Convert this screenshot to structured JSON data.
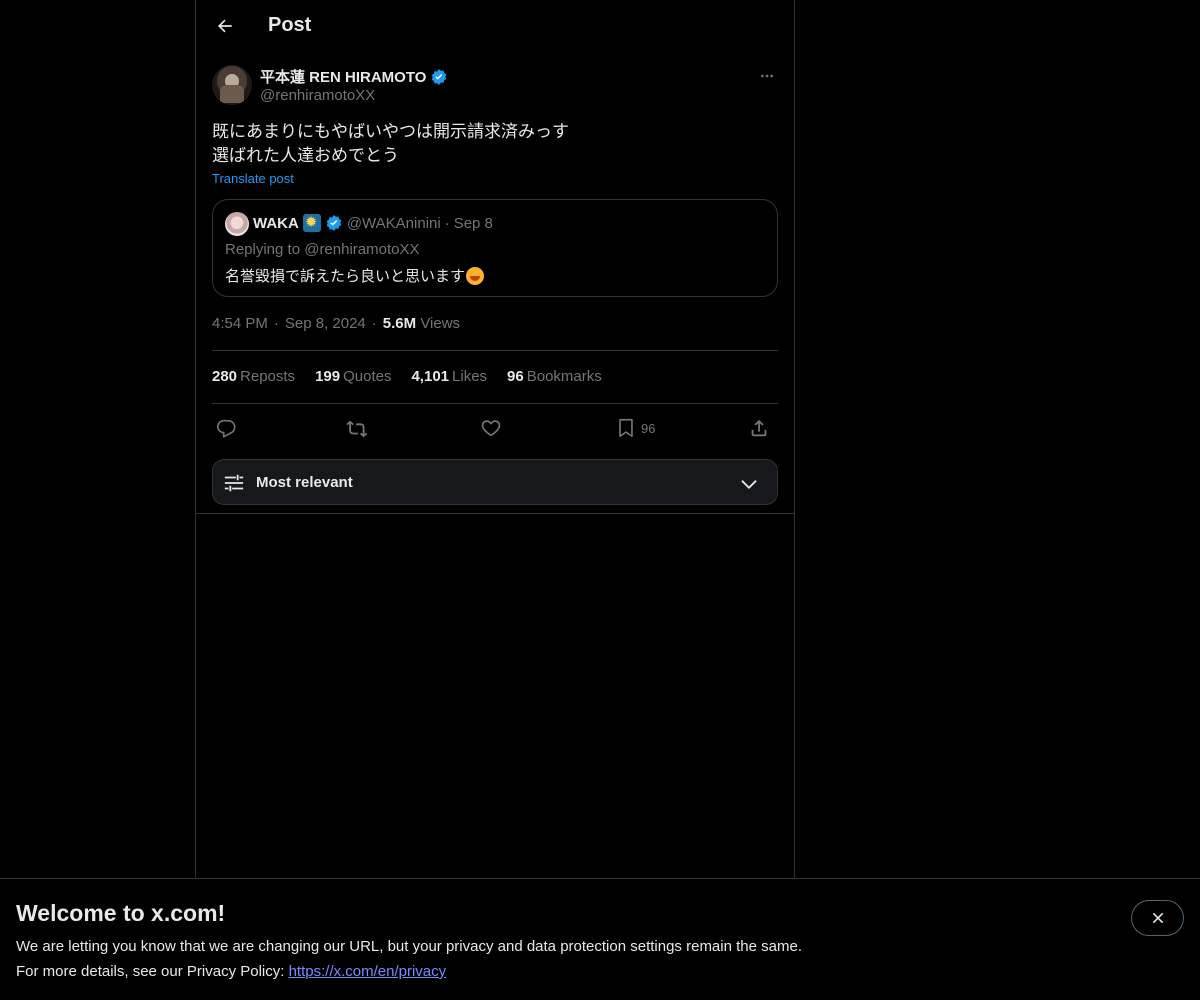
{
  "header": {
    "title": "Post"
  },
  "post": {
    "display_name": "平本蓮 REN HIRAMOTO",
    "handle": "@renhiramotoXX",
    "text": "既にあまりにもやばいやつは開示請求済みっす\n選ばれた人達おめでとう",
    "translate_label": "Translate post",
    "time": "4:54 PM",
    "date": "Sep 8, 2024",
    "views_count": "5.6M",
    "views_label": "Views"
  },
  "quote": {
    "display_name": "WAKA",
    "handle": "@WAKAninini",
    "separator": "·",
    "date": "Sep 8",
    "replying": "Replying to @renhiramotoXX",
    "text": "名誉毀損で訴えたら良いと思います"
  },
  "stats": {
    "reposts_count": "280",
    "reposts_label": "Reposts",
    "quotes_count": "199",
    "quotes_label": "Quotes",
    "likes_count": "4,101",
    "likes_label": "Likes",
    "bookmarks_count": "96",
    "bookmarks_label": "Bookmarks"
  },
  "actions": {
    "bookmark_count": "96"
  },
  "sort": {
    "label": "Most relevant"
  },
  "banner": {
    "title": "Welcome to x.com!",
    "line1": "We are letting you know that we are changing our URL, but your privacy and data protection settings remain the same.",
    "line2_prefix": "For more details, see our Privacy Policy: ",
    "link": "https://x.com/en/privacy"
  },
  "colors": {
    "accent": "#1d9bf0",
    "muted": "#71767b",
    "text": "#e7e9ea",
    "border": "#2f3336",
    "link": "#7c88ff"
  },
  "icons": [
    "arrow-left-icon",
    "verified-badge-icon",
    "more-icon",
    "reply-icon",
    "repost-icon",
    "like-icon",
    "bookmark-icon",
    "share-icon",
    "sliders-icon",
    "chevron-down-icon",
    "close-icon"
  ]
}
